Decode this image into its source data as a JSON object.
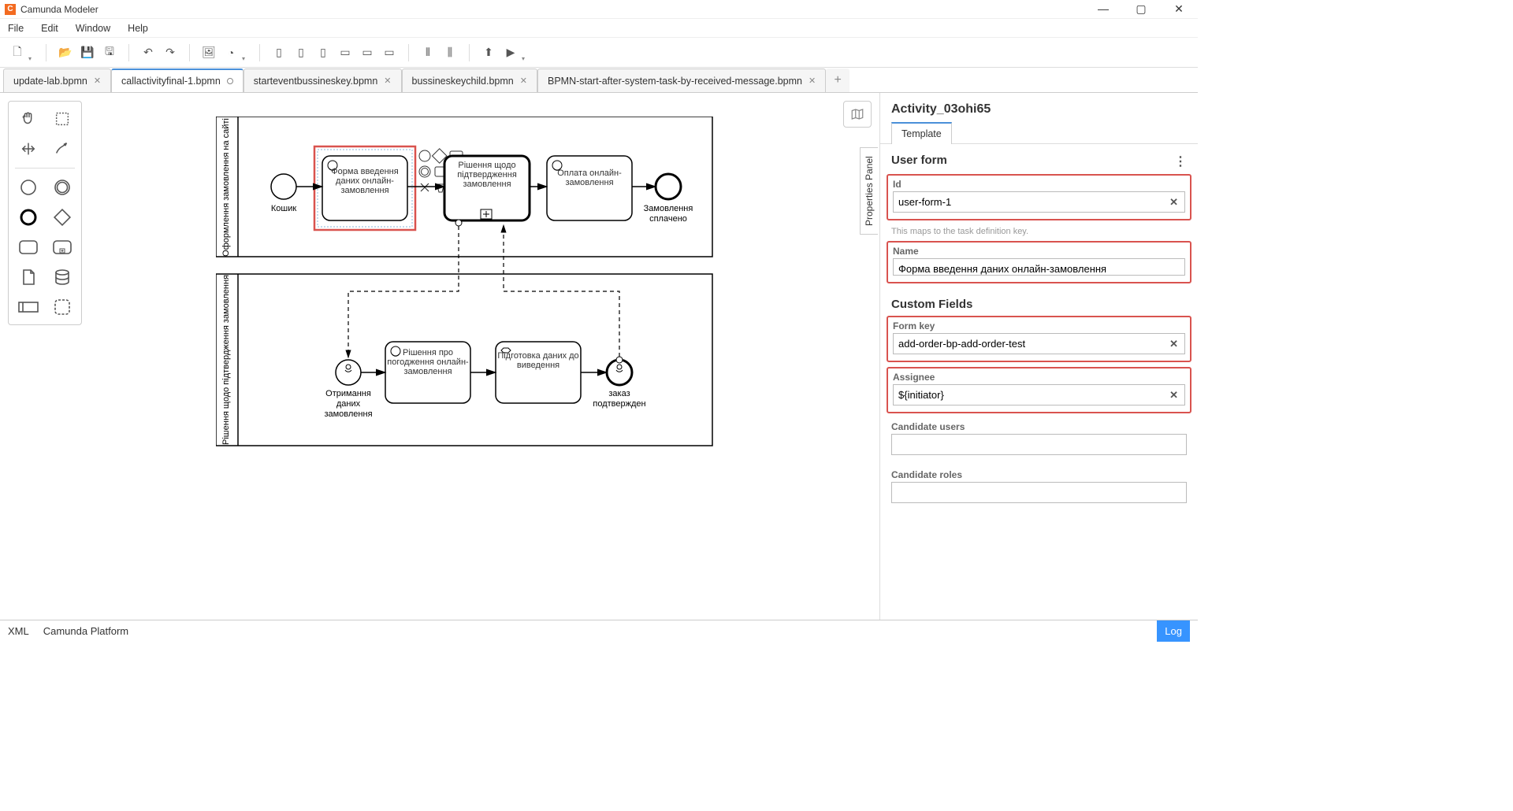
{
  "window": {
    "title": "Camunda Modeler",
    "app_initial": "C"
  },
  "menu": [
    "File",
    "Edit",
    "Window",
    "Help"
  ],
  "tabs": [
    {
      "label": "update-lab.bpmn",
      "dirty": false
    },
    {
      "label": "callactivityfinal-1.bpmn",
      "dirty": true,
      "active": true
    },
    {
      "label": "starteventbussineskey.bpmn",
      "dirty": false
    },
    {
      "label": "bussineskeychild.bpmn",
      "dirty": false
    },
    {
      "label": "BPMN-start-after-system-task-by-received-message.bpmn",
      "dirty": false
    }
  ],
  "diagram": {
    "lane1": "Оформлення замовлення на сайті",
    "lane2": "Рішення щодо підтвердження замовлення",
    "start1": "Кошик",
    "task1": "Форма введення даних онлайн-замовлення",
    "task2": "Рішення щодо підтвердження замовлення",
    "task3": "Оплата онлайн-замовлення",
    "end1a": "Замовлення",
    "end1b": "сплачено",
    "start2a": "Отримання",
    "start2b": "даних",
    "start2c": "замовлення",
    "task4": "Рішення про погодження онлайн-замовлення",
    "task5": "Підготовка даних до виведення",
    "end2a": "заказ",
    "end2b": "подтвержден"
  },
  "panel": {
    "header": "Activity_03ohi65",
    "tab": "Template",
    "vtab": "Properties Panel",
    "section_userform": "User form",
    "section_custom": "Custom Fields",
    "fields": {
      "id_label": "Id",
      "id_value": "user-form-1",
      "id_hint": "This maps to the task definition key.",
      "name_label": "Name",
      "name_value": "Форма введення даних онлайн-замовлення",
      "formkey_label": "Form key",
      "formkey_value": "add-order-bp-add-order-test",
      "assignee_label": "Assignee",
      "assignee_value": "${initiator}",
      "cand_users_label": "Candidate users",
      "cand_roles_label": "Candidate roles"
    }
  },
  "status": {
    "xml": "XML",
    "platform": "Camunda Platform",
    "log": "Log"
  }
}
